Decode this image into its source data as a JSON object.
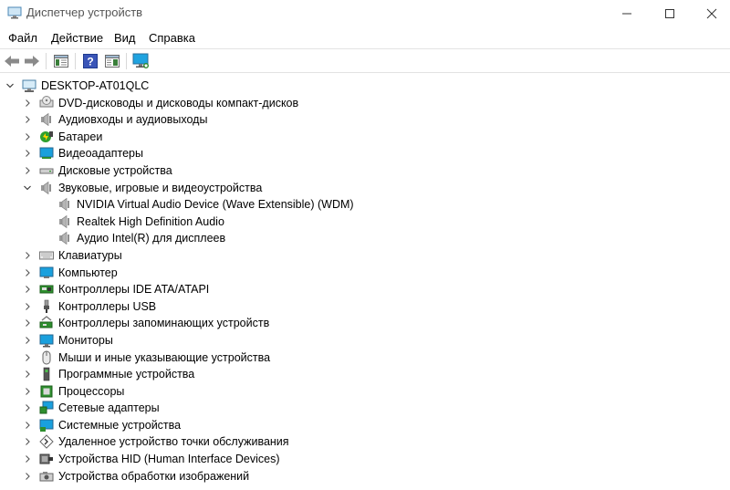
{
  "window": {
    "title": "Диспетчер устройств"
  },
  "menu": [
    "Файл",
    "Действие",
    "Вид",
    "Справка"
  ],
  "toolbar": {
    "buttons": [
      "back-arrow-icon",
      "forward-arrow-icon",
      "properties-pane-icon",
      "help-icon",
      "update-driver-icon",
      "scan-hardware-icon"
    ]
  },
  "tree": {
    "root": "DESKTOP-AT01QLC",
    "categories": [
      {
        "label": "DVD-дисководы и дисководы компакт-дисков",
        "icon": "dvd-drive-icon",
        "expanded": false
      },
      {
        "label": "Аудиовходы и аудиовыходы",
        "icon": "speaker-icon",
        "expanded": false
      },
      {
        "label": "Батареи",
        "icon": "battery-icon",
        "expanded": false
      },
      {
        "label": "Видеоадаптеры",
        "icon": "display-adapter-icon",
        "expanded": false
      },
      {
        "label": "Дисковые устройства",
        "icon": "disk-drive-icon",
        "expanded": false
      },
      {
        "label": "Звуковые, игровые и видеоустройства",
        "icon": "speaker-icon",
        "expanded": true,
        "children": [
          "NVIDIA Virtual Audio Device (Wave Extensible) (WDM)",
          "Realtek High Definition Audio",
          "Аудио Intel(R) для дисплеев"
        ]
      },
      {
        "label": "Клавиатуры",
        "icon": "keyboard-icon",
        "expanded": false
      },
      {
        "label": "Компьютер",
        "icon": "computer-icon",
        "expanded": false
      },
      {
        "label": "Контроллеры IDE ATA/ATAPI",
        "icon": "ide-controller-icon",
        "expanded": false
      },
      {
        "label": "Контроллеры USB",
        "icon": "usb-icon",
        "expanded": false
      },
      {
        "label": "Контроллеры запоминающих устройств",
        "icon": "storage-controller-icon",
        "expanded": false
      },
      {
        "label": "Мониторы",
        "icon": "monitor-icon",
        "expanded": false
      },
      {
        "label": "Мыши и иные указывающие устройства",
        "icon": "mouse-icon",
        "expanded": false
      },
      {
        "label": "Программные устройства",
        "icon": "software-device-icon",
        "expanded": false
      },
      {
        "label": "Процессоры",
        "icon": "processor-icon",
        "expanded": false
      },
      {
        "label": "Сетевые адаптеры",
        "icon": "network-adapter-icon",
        "expanded": false
      },
      {
        "label": "Системные устройства",
        "icon": "system-device-icon",
        "expanded": false
      },
      {
        "label": "Удаленное устройство точки обслуживания",
        "icon": "remote-device-icon",
        "expanded": false
      },
      {
        "label": "Устройства HID (Human Interface Devices)",
        "icon": "hid-icon",
        "expanded": false
      },
      {
        "label": "Устройства обработки изображений",
        "icon": "imaging-device-icon",
        "expanded": false
      }
    ]
  }
}
